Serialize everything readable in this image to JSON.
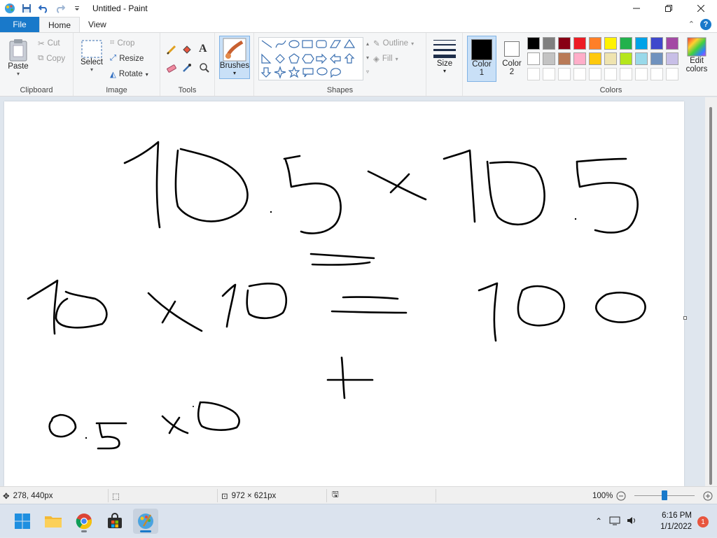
{
  "window": {
    "title": "Untitled - Paint"
  },
  "tabs": {
    "file": "File",
    "home": "Home",
    "view": "View"
  },
  "ribbon": {
    "clipboard": {
      "label": "Clipboard",
      "paste": "Paste",
      "cut": "Cut",
      "copy": "Copy"
    },
    "image": {
      "label": "Image",
      "select": "Select",
      "crop": "Crop",
      "resize": "Resize",
      "rotate": "Rotate"
    },
    "tools": {
      "label": "Tools"
    },
    "brushes": {
      "label": "Brushes"
    },
    "shapes": {
      "label": "Shapes",
      "outline": "Outline",
      "fill": "Fill"
    },
    "size": {
      "label": "Size"
    },
    "color1": {
      "label_line1": "Color",
      "label_line2": "1",
      "value": "#000000"
    },
    "color2": {
      "label_line1": "Color",
      "label_line2": "2",
      "value": "#ffffff"
    },
    "colors": {
      "label": "Colors",
      "edit_line1": "Edit",
      "edit_line2": "colors",
      "row1": [
        "#000000",
        "#7f7f7f",
        "#880015",
        "#ed1c24",
        "#ff7f27",
        "#fff200",
        "#22b14c",
        "#00a2e8",
        "#3f48cc",
        "#a349a4"
      ],
      "row2": [
        "#ffffff",
        "#c3c3c3",
        "#b97a57",
        "#ffaec9",
        "#ffc90e",
        "#efe4b0",
        "#b5e61d",
        "#99d9ea",
        "#7092be",
        "#c8bfe7"
      ],
      "row3": [
        "#ffffff",
        "#ffffff",
        "#ffffff",
        "#ffffff",
        "#ffffff",
        "#ffffff",
        "#ffffff",
        "#ffffff",
        "#ffffff",
        "#ffffff"
      ]
    }
  },
  "status": {
    "cursor_pos": "278, 440px",
    "canvas_size": "972 × 621px",
    "zoom": "100%",
    "zoom_fraction": 0.5
  },
  "taskbar": {
    "time": "6:16 PM",
    "date": "1/1/2022",
    "notifications": "1"
  }
}
